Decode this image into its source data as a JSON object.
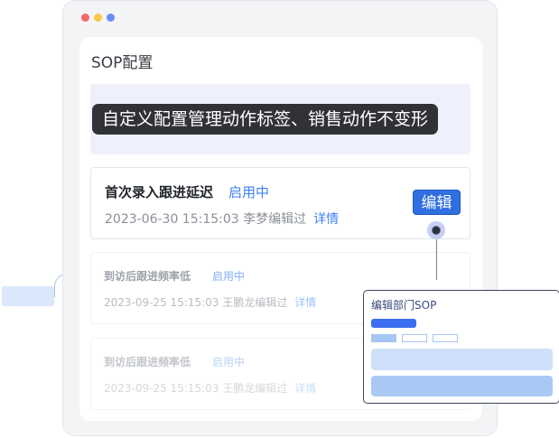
{
  "window": {
    "title": "SOP配置",
    "traffic_lights": [
      "red-dot",
      "yellow-dot",
      "blue-dot"
    ]
  },
  "tooltip": {
    "text": "自定义配置管理动作标签、销售动作不变形"
  },
  "cards": [
    {
      "title": "首次录入跟进延迟",
      "status": "启用中",
      "meta": "2023-06-30 15:15:03 李梦编辑过",
      "detail": "详情"
    },
    {
      "title": "到访后跟进频率低",
      "status": "启用中",
      "meta": "2023-09-25 15:15:03 王鹏龙编辑过",
      "detail": "详情"
    },
    {
      "title": "到访后跟进频率低",
      "status": "启用中",
      "meta": "2023-09-25 15:15:03 王鹏龙编辑过",
      "detail": "详情"
    }
  ],
  "edit_button": {
    "label": "编辑"
  },
  "popover": {
    "title": "编辑部门SOP"
  },
  "colors": {
    "accent": "#2f6fe0",
    "status_blue": "#3b82f6",
    "tooltip_bg": "#303236"
  }
}
